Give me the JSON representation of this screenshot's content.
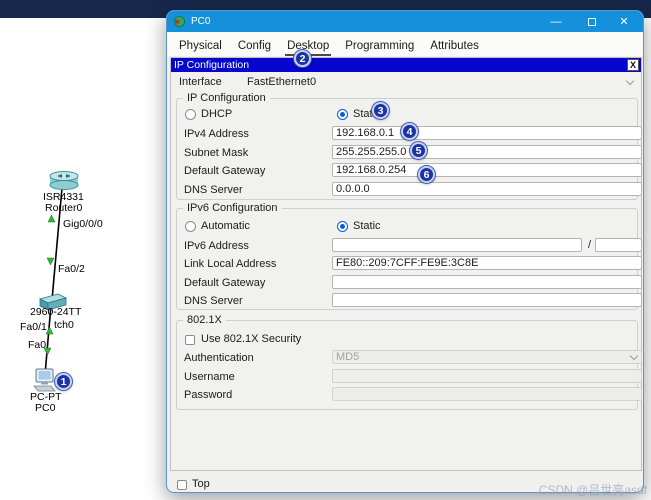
{
  "watermark": "CSDN @吕世亮asdf",
  "topology": {
    "router_model": "ISR4331",
    "router_name": "Router0",
    "router_port": "Gig0/0/0",
    "link1_switch_port": "Fa0/2",
    "switch_model": "2960-24TT",
    "switch_port": "Fa0/1",
    "switch_name_partial": "tch0",
    "pc_port": "Fa0",
    "pc_model": "PC-PT",
    "pc_name": "PC0"
  },
  "annotations": {
    "a1": "1",
    "a2": "2",
    "a3": "3",
    "a4": "4",
    "a5": "5",
    "a6": "6"
  },
  "window": {
    "title": "PC0",
    "controls": {
      "minimize": "—",
      "close": "✕"
    },
    "tabs": [
      {
        "label": "Physical"
      },
      {
        "label": "Config"
      },
      {
        "label": "Desktop"
      },
      {
        "label": "Programming"
      },
      {
        "label": "Attributes"
      }
    ],
    "ipconfig": {
      "title": "IP Configuration",
      "close_label": "X",
      "interface": {
        "label": "Interface",
        "value": "FastEthernet0"
      },
      "ipv4": {
        "group_title": "IP Configuration",
        "dhcp": "DHCP",
        "static": "Static",
        "address_label": "IPv4 Address",
        "address_value": "192.168.0.1",
        "mask_label": "Subnet Mask",
        "mask_value": "255.255.255.0",
        "gateway_label": "Default Gateway",
        "gateway_value": "192.168.0.254",
        "dns_label": "DNS Server",
        "dns_value": "0.0.0.0"
      },
      "ipv6": {
        "group_title": "IPv6 Configuration",
        "automatic": "Automatic",
        "static": "Static",
        "address_label": "IPv6 Address",
        "prefix_separator": "/",
        "link_local_label": "Link Local Address",
        "link_local_value": "FE80::209:7CFF:FE9E:3C8E",
        "gateway_label": "Default Gateway",
        "dns_label": "DNS Server"
      },
      "dot1x": {
        "group_title": "802.1X",
        "use_security": "Use 802.1X Security",
        "auth_label": "Authentication",
        "auth_value": "MD5",
        "username_label": "Username",
        "password_label": "Password"
      }
    },
    "footer": {
      "top_label": "Top"
    }
  }
}
